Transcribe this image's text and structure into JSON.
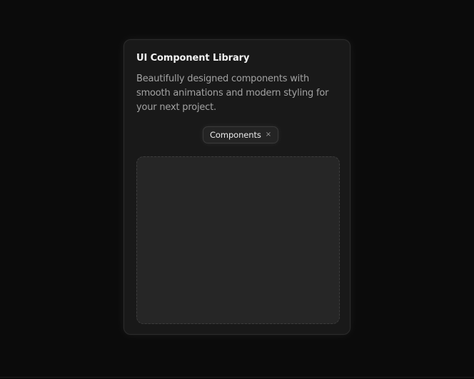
{
  "card": {
    "title": "UI Component Library",
    "description": "Beautifully designed components with smooth animations and modern styling for your next project."
  },
  "tag": {
    "label": "Components",
    "close_glyph": "×",
    "close_icon": "close-icon"
  },
  "colors": {
    "background": "#0b0b0b",
    "card": "#191919",
    "panel": "#262626"
  }
}
